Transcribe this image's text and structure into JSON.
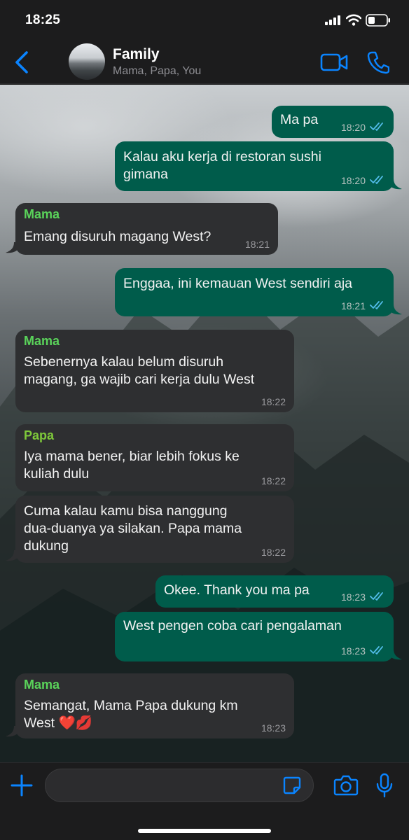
{
  "status": {
    "time": "18:25"
  },
  "header": {
    "title": "Family",
    "subtitle": "Mama, Papa, You"
  },
  "colors": {
    "accent": "#0a84ff",
    "outgoing_bubble": "#005c4b",
    "incoming_bubble": "#2e2f31",
    "mama_name": "#5ad35a",
    "papa_name": "#7ec83a"
  },
  "messages": [
    {
      "dir": "out",
      "lines": [
        "Ma pa"
      ],
      "time": "18:20",
      "read": true
    },
    {
      "dir": "out",
      "lines": [
        "Kalau aku kerja di restoran sushi",
        "gimana"
      ],
      "time": "18:20",
      "read": true
    },
    {
      "dir": "in",
      "sender": "Mama",
      "lines": [
        "Emang disuruh magang West?"
      ],
      "time": "18:21"
    },
    {
      "dir": "out",
      "lines": [
        "Enggaa, ini kemauan West sendiri aja"
      ],
      "time": "18:21",
      "read": true
    },
    {
      "dir": "in",
      "sender": "Mama",
      "lines": [
        "Sebenernya kalau belum disuruh",
        "magang, ga wajib cari kerja dulu West"
      ],
      "time": "18:22"
    },
    {
      "dir": "in",
      "sender": "Papa",
      "lines": [
        "Iya mama bener, biar lebih fokus ke",
        "kuliah dulu"
      ],
      "time": "18:22"
    },
    {
      "dir": "in",
      "lines": [
        "Cuma kalau kamu bisa nanggung",
        "dua-duanya ya silakan. Papa mama",
        "dukung"
      ],
      "time": "18:22"
    },
    {
      "dir": "out",
      "lines": [
        "Okee. Thank you ma pa"
      ],
      "time": "18:23",
      "read": true
    },
    {
      "dir": "out",
      "lines": [
        "West pengen coba cari pengalaman"
      ],
      "time": "18:23",
      "read": true
    },
    {
      "dir": "in",
      "sender": "Mama",
      "lines": [
        "Semangat, Mama Papa dukung km",
        "West ❤️💋"
      ],
      "time": "18:23"
    }
  ],
  "icons": {
    "back": "chevron-left-icon",
    "video": "video-call-icon",
    "phone": "phone-call-icon",
    "plus": "plus-icon",
    "sticker": "sticker-icon",
    "camera": "camera-icon",
    "mic": "microphone-icon"
  }
}
